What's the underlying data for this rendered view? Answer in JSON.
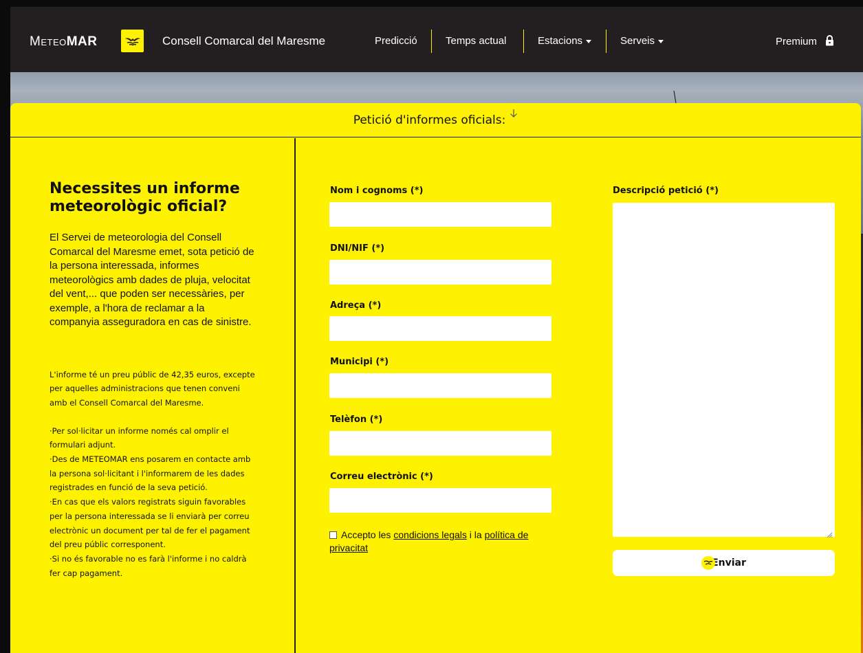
{
  "navbar": {
    "brand_light": "Meteo",
    "brand_bold": "MAR",
    "org_name": "Consell Comarcal del Maresme",
    "items": [
      {
        "label": "Predicció"
      },
      {
        "label": "Temps actual"
      },
      {
        "label": "Estacions"
      },
      {
        "label": "Serveis"
      }
    ],
    "premium_label": "Premium"
  },
  "panel": {
    "title": "Petició d'informes oficials:"
  },
  "info": {
    "headline": "Necessites un informe meteorològic oficial?",
    "intro": "El Servei de meteorologia del Consell Comarcal del Maresme emet, sota petició de la persona interessada, informes meteorològics amb dades de pluja, velocitat del vent,... que poden ser necessàries, per exemple, a l'hora de reclamar a la companyia asseguradora en cas de sinistre.",
    "price": "L'informe té un preu públic de 42,35 euros, excepte per aquelles administracions que tenen conveni amb el Consell Comarcal del Maresme.",
    "steps": [
      "·Per sol·licitar un informe només cal omplir el formulari adjunt.",
      "·Des de METEOMAR ens posarem en contacte amb la persona sol·licitant i l'informarem de les dades registrades en funció de la seva petició.",
      "·En cas que els valors registrats siguin favorables per la persona interessada se li enviarà per correu electrònic un document per tal de fer el pagament del preu públic corresponent.",
      "·Si no és favorable no es farà l'informe i no caldrà fer cap pagament."
    ]
  },
  "form": {
    "name_label": "Nom i cognoms (*)",
    "name_value": "",
    "dni_label": "DNI/NIF (*)",
    "dni_value": "",
    "address_label": "Adreça (*)",
    "address_value": "",
    "city_label": "Municipi (*)",
    "city_value": "",
    "phone_label": "Telèfon (*)",
    "phone_value": "",
    "email_label": "Correu electrònic (*)",
    "email_value": "",
    "description_label": "Descripció petició (*)",
    "description_value": "",
    "consent_prefix": "Accepto les",
    "consent_link1": "condicions legals",
    "consent_mid": "i la",
    "consent_link2": "política de privacitat",
    "consent_checked": false,
    "submit_label": "Enviar"
  },
  "colors": {
    "accent_yellow": "#fff200",
    "navbar_bg": "#231f20"
  }
}
